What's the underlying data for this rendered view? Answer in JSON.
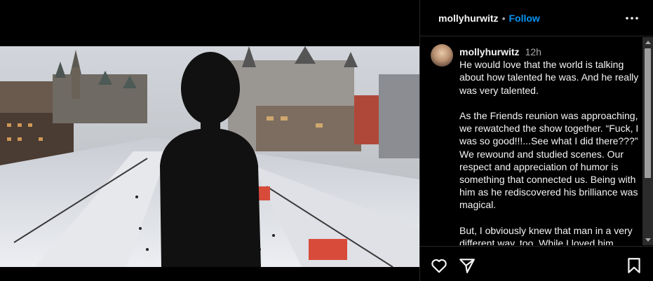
{
  "post": {
    "username": "mollyhurwitz",
    "separator": "•",
    "follow_label": "Follow"
  },
  "comment": {
    "username": "mollyhurwitz",
    "time": "12h",
    "caption": "He would love that the world is talking about how talented he was. And he really was very talented.\n\nAs the Friends reunion was approaching, we rewatched the show together. “Fuck, I was so good!!!...See what I did there???” We rewound and studied scenes. Our respect and appreciation of humor is something that connected us. Being with him as he rediscovered his brilliance was magical.\n\nBut, I obviously knew that man in a very different way, too. While I loved him"
  },
  "icons": {
    "more": "more-options-icon",
    "like": "heart-icon",
    "share": "share-icon",
    "save": "bookmark-icon"
  },
  "colors": {
    "follow": "#0095f6",
    "background": "#000000",
    "text": "#f5f5f5",
    "secondary": "#a8a8a8"
  }
}
